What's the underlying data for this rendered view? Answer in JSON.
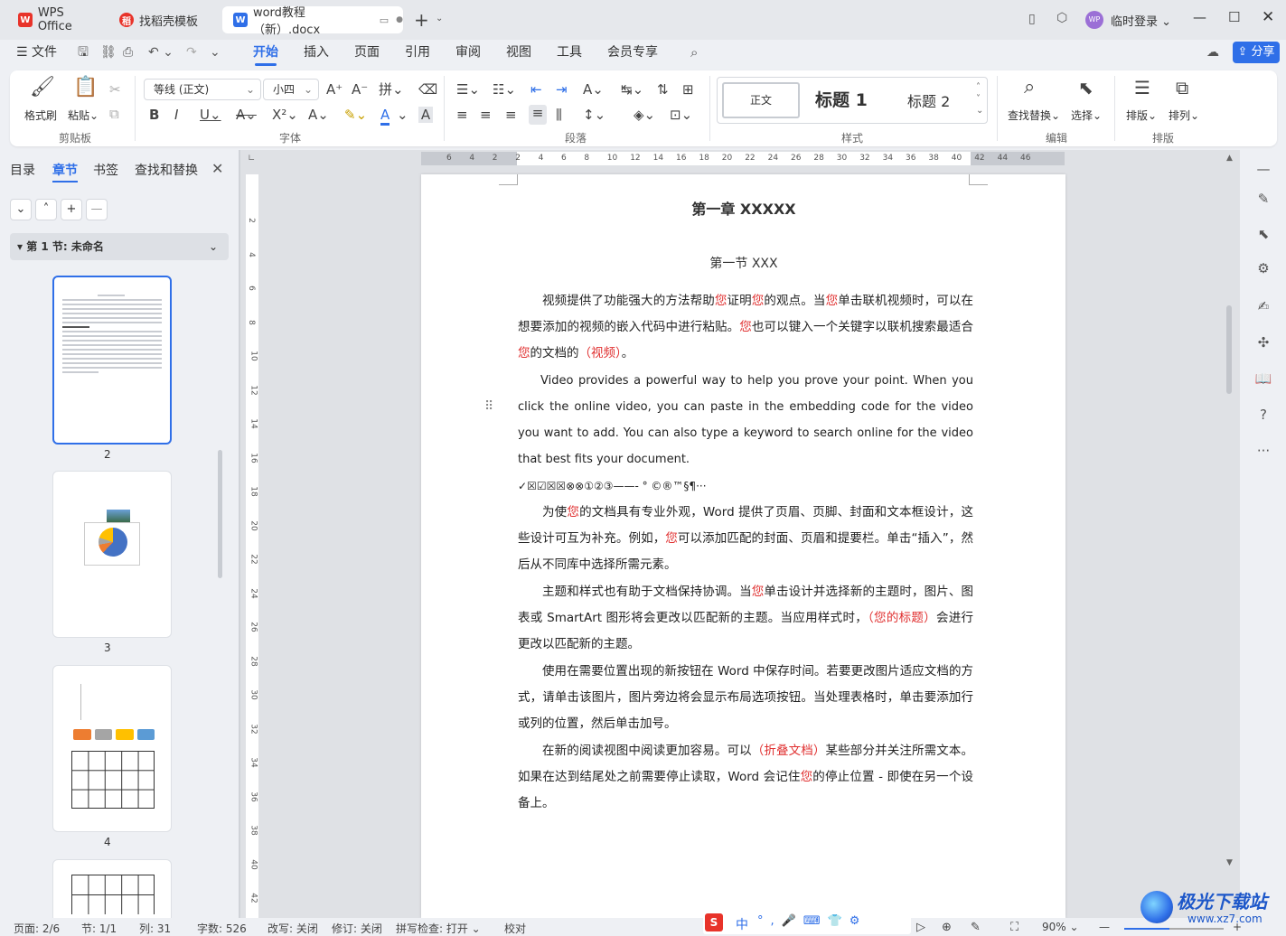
{
  "tabs": {
    "wps_home": "WPS Office",
    "template": "找稻壳模板",
    "doc": "word教程（新）.docx",
    "new_tab": "+",
    "login": "临时登录",
    "avatar": "WP"
  },
  "menu": {
    "file": "文件",
    "items": [
      "开始",
      "插入",
      "页面",
      "引用",
      "审阅",
      "视图",
      "工具",
      "会员专享"
    ],
    "share": "分享"
  },
  "ribbon": {
    "clipboard": {
      "format_painter": "格式刷",
      "paste": "粘贴",
      "group": "剪贴板"
    },
    "font": {
      "name": "等线 (正文)",
      "size": "小四",
      "group": "字体"
    },
    "paragraph": {
      "group": "段落"
    },
    "styles": {
      "normal": "正文",
      "heading1": "标题  1",
      "heading2": "标题  2",
      "group": "样式"
    },
    "edit": {
      "find_replace": "查找替换",
      "select": "选择",
      "group": "编辑"
    },
    "arrange": {
      "layout": "排版",
      "order": "排列",
      "group": "排版"
    }
  },
  "left_panel": {
    "tabs": [
      "目录",
      "章节",
      "书签",
      "查找和替换"
    ],
    "section_title": "第 1 节: 未命名",
    "page_numbers": [
      "2",
      "3",
      "4"
    ]
  },
  "ruler": {
    "h_ticks": [
      "6",
      "4",
      "2",
      "2",
      "4",
      "6",
      "8",
      "10",
      "12",
      "14",
      "16",
      "18",
      "20",
      "22",
      "24",
      "26",
      "28",
      "30",
      "32",
      "34",
      "36",
      "38",
      "40",
      "42",
      "44",
      "46"
    ],
    "v_ticks": [
      "2",
      "4",
      "6",
      "8",
      "10",
      "12",
      "14",
      "16",
      "18",
      "20",
      "22",
      "24",
      "26",
      "28",
      "30",
      "32",
      "34",
      "36",
      "38",
      "40",
      "42"
    ]
  },
  "document": {
    "chapter_title": "第一章 XXXXX",
    "section_title": "第一节 XXX",
    "p1_parts": [
      "视频提供了功能强大的方法帮助",
      "您",
      "证明",
      "您",
      "的观点。当",
      "您",
      "单击联机视频时，可以在想要添加的视频的嵌入代码中进行粘贴。",
      "您",
      "也可以键入一个关键字以联机搜索最适合",
      "您",
      "的文档的",
      "（视频）",
      "。"
    ],
    "p2": "Video provides a powerful way to help you prove your point. When you click the online video, you can paste in the embedding code for the video you want to add. You can also type a keyword to search online for the video that best fits your document.",
    "symbols": "✓☒☑☒☒⊗⊗①②③——‐    °  ©®™§¶···",
    "p3_parts": [
      "为使",
      "您",
      "的文档具有专业外观，Word 提供了页眉、页脚、封面和文本框设计，这些设计可互为补充。例如，",
      "您",
      "可以添加匹配的封面、页眉和提要栏。单击“插入”，然后从不同库中选择所需元素。"
    ],
    "p4_parts": [
      "主题和样式也有助于文档保持协调。当",
      "您",
      "单击设计并选择新的主题时，图片、图表或 SmartArt 图形将会更改以匹配新的主题。当应用样式时，",
      "（您的标题）",
      "会进行更改以匹配新的主题。"
    ],
    "p5": "使用在需要位置出现的新按钮在 Word 中保存时间。若要更改图片适应文档的方式，请单击该图片，图片旁边将会显示布局选项按钮。当处理表格时，单击要添加行或列的位置，然后单击加号。",
    "p6_parts": [
      "在新的阅读视图中阅读更加容易。可以",
      "（折叠文档）",
      "某些部分并关注所需文本。如果在达到结尾处之前需要停止读取，Word 会记住",
      "您",
      "的停止位置 - 即使在另一个设备上。"
    ]
  },
  "statusbar": {
    "page": "页面: 2/6",
    "section": "节: 1/1",
    "column": "列: 31",
    "words": "字数: 526",
    "revise": "改写: 关闭",
    "track": "修订: 关闭",
    "spell": "拼写检查: 打开",
    "proof": "校对",
    "zoom": "90%",
    "ime": "中"
  },
  "watermark": {
    "text": "极光下载站",
    "url": "www.xz7.com"
  },
  "colors": {
    "accent": "#2f6fe8",
    "red_text": "#e03030",
    "wps_red": "#e8332a"
  }
}
